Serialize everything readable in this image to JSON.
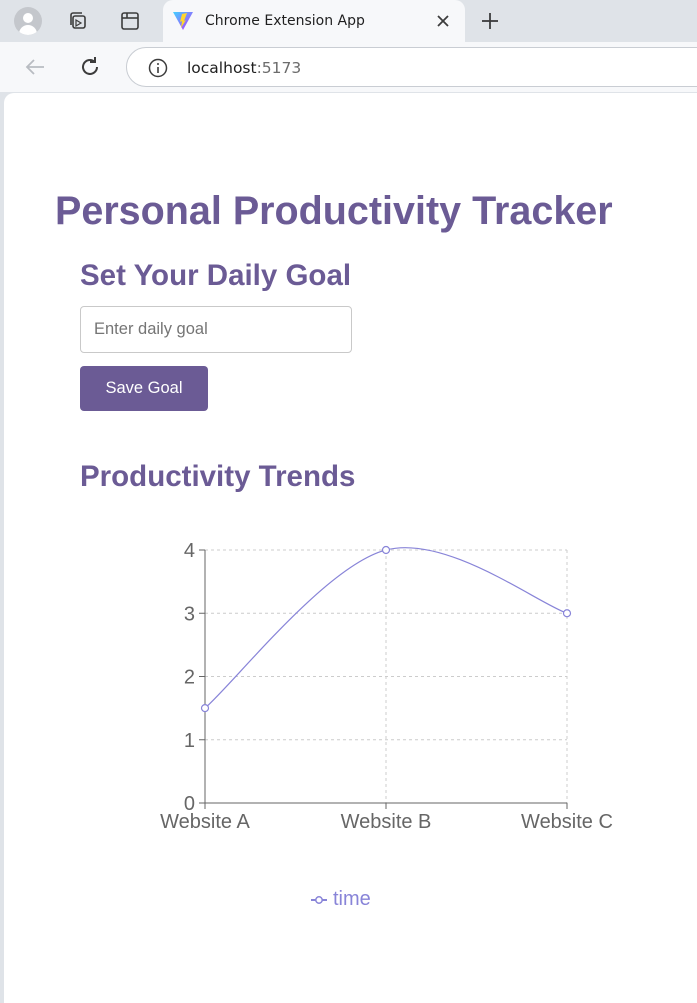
{
  "browser": {
    "tab_title": "Chrome Extension App",
    "url_host": "localhost",
    "url_port": ":5173"
  },
  "app": {
    "title": "Personal Productivity Tracker",
    "goal_section": {
      "heading": "Set Your Daily Goal",
      "input_placeholder": "Enter daily goal",
      "input_value": "",
      "save_label": "Save Goal"
    },
    "trends_section": {
      "heading": "Productivity Trends"
    }
  },
  "colors": {
    "accent": "#6b5b95",
    "series": "#8884d8"
  },
  "chart_data": {
    "type": "line",
    "categories": [
      "Website A",
      "Website B",
      "Website C"
    ],
    "series": [
      {
        "name": "time",
        "values": [
          1.5,
          4,
          3
        ]
      }
    ],
    "yticks": [
      0,
      1,
      2,
      3,
      4
    ],
    "ylim": [
      0,
      4
    ],
    "grid": true,
    "curve": "smooth",
    "legend_position": "bottom"
  }
}
